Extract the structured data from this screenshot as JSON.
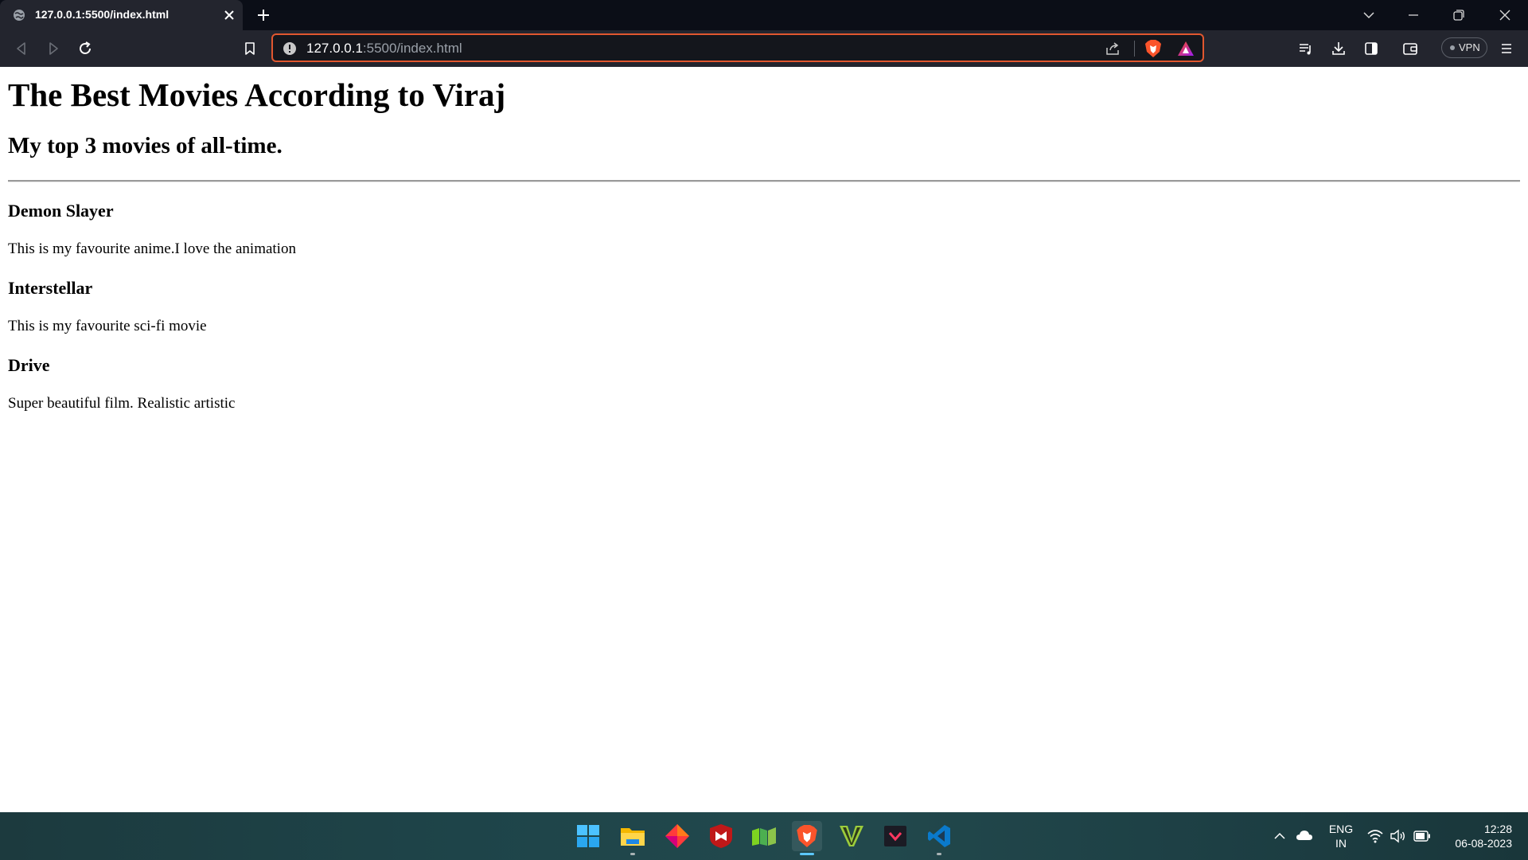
{
  "browser": {
    "tab": {
      "title": "127.0.0.1:5500/index.html"
    },
    "address": {
      "host": "127.0.0.1",
      "path": ":5500/index.html"
    },
    "vpn_label": "VPN",
    "accent_color": "#e1572f"
  },
  "page": {
    "title": "The Best Movies According to Viraj",
    "subtitle": "My top 3 movies of all-time.",
    "movies": [
      {
        "name": "Demon Slayer",
        "description": "This is my favourite anime.I love the animation"
      },
      {
        "name": "Interstellar",
        "description": "This is my favourite sci-fi movie"
      },
      {
        "name": "Drive",
        "description": "Super beautiful film. Realistic artistic"
      }
    ]
  },
  "taskbar": {
    "apps": [
      "start-icon",
      "file-explorer-icon",
      "app-diamond-icon",
      "mcafee-icon",
      "app-green-icon",
      "brave-icon",
      "v-app-icon",
      "app-dark-icon",
      "vscode-icon"
    ],
    "active_app": "brave-icon",
    "language": {
      "line1": "ENG",
      "line2": "IN"
    },
    "clock": {
      "time": "12:28",
      "date": "06-08-2023"
    }
  }
}
